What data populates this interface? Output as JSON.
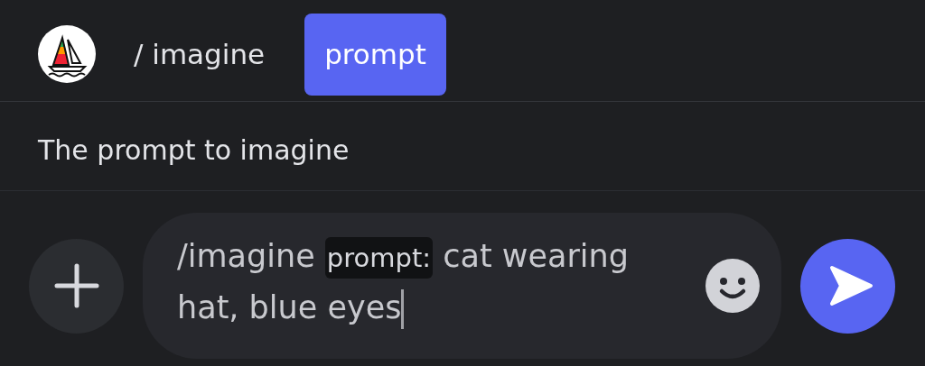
{
  "command_bar": {
    "command": "/ imagine",
    "options": [
      {
        "label": "prompt",
        "selected": true
      }
    ]
  },
  "option_description": "The prompt to imagine",
  "composer": {
    "command": "/imagine",
    "option_chip": "prompt:",
    "value_lines": [
      "cat wearing",
      "hat, blue eyes"
    ]
  }
}
